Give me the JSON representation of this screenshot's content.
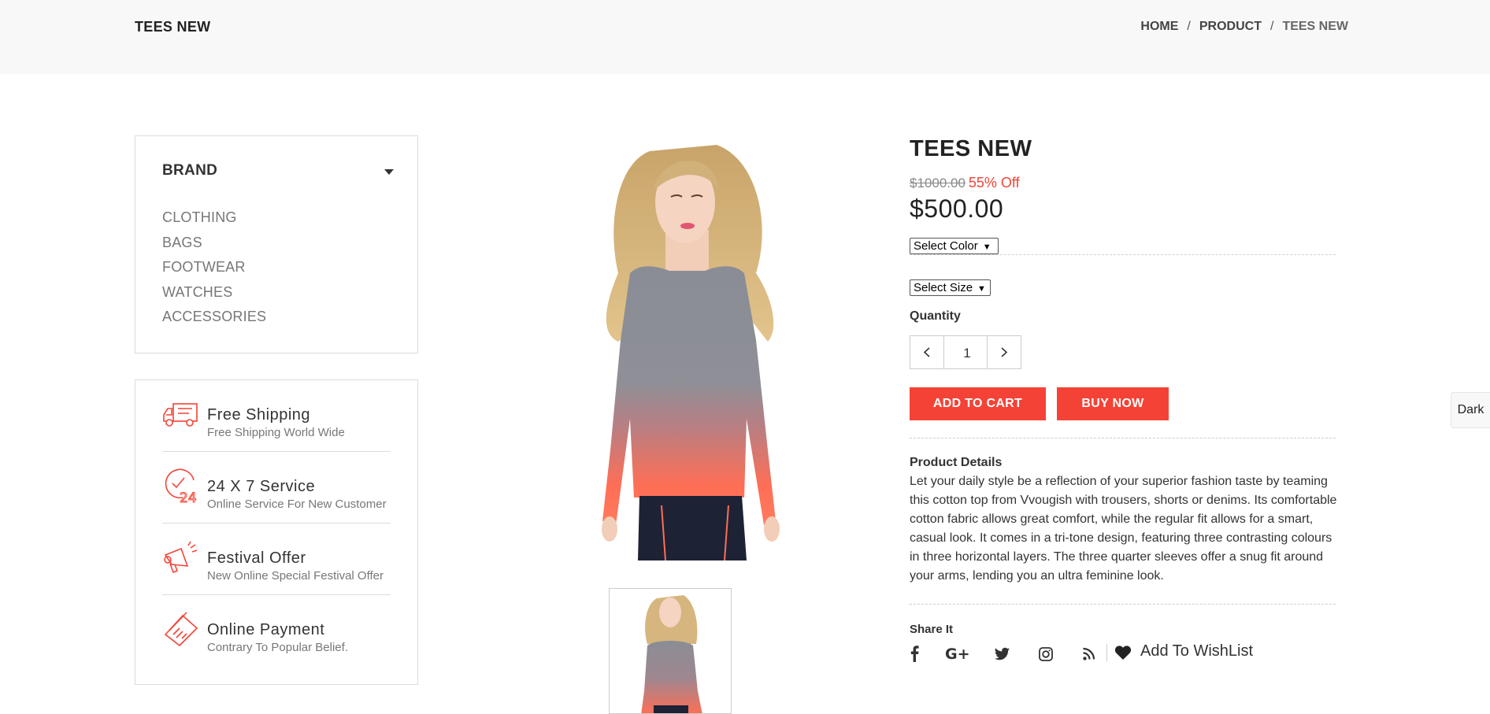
{
  "header": {
    "page_title": "TEES NEW",
    "breadcrumb": [
      {
        "label": "HOME"
      },
      {
        "label": "PRODUCT"
      },
      {
        "label": "TEES NEW"
      }
    ],
    "separator": "/"
  },
  "sidebar": {
    "brand_title": "BRAND",
    "categories": [
      "CLOTHING",
      "BAGS",
      "FOOTWEAR",
      "WATCHES",
      "ACCESSORIES"
    ],
    "services": [
      {
        "title": "Free Shipping",
        "subtitle": "Free Shipping World Wide",
        "icon": "truck-icon"
      },
      {
        "title": "24 X 7 Service",
        "subtitle": "Online Service For New Customer",
        "icon": "clock-24-icon"
      },
      {
        "title": "Festival Offer",
        "subtitle": "New Online Special Festival Offer",
        "icon": "megaphone-icon"
      },
      {
        "title": "Online Payment",
        "subtitle": "Contrary To Popular Belief.",
        "icon": "credit-card-icon"
      }
    ]
  },
  "product": {
    "name": "TEES NEW",
    "old_price": "$1000.00",
    "discount": "55% Off",
    "price": "$500.00",
    "color_select": "Select Color",
    "size_select": "Select Size",
    "quantity_label": "Quantity",
    "quantity_value": "1",
    "add_to_cart": "ADD TO CART",
    "buy_now": "BUY NOW",
    "details_title": "Product Details",
    "details_text": "Let your daily style be a reflection of your superior fashion taste by teaming this cotton top from Vvougish with trousers, shorts or denims. Its comfortable cotton fabric allows great comfort, while the regular fit allows for a smart, casual look. It comes in a tri-tone design, featuring three contrasting colours in three horizontal layers. The three quarter sleeves offer a snug fit around your arms, lending you an ultra feminine look.",
    "share_title": "Share It",
    "share_icons": [
      "facebook-icon",
      "google-plus-icon",
      "twitter-icon",
      "instagram-icon",
      "rss-icon"
    ],
    "wishlist": "Add To WishList"
  },
  "dark_toggle": "Dark",
  "colors": {
    "accent": "#f44336",
    "header_bg": "#f8f8f8",
    "text": "#222222",
    "muted": "#777777",
    "border": "#dcdcdc"
  }
}
